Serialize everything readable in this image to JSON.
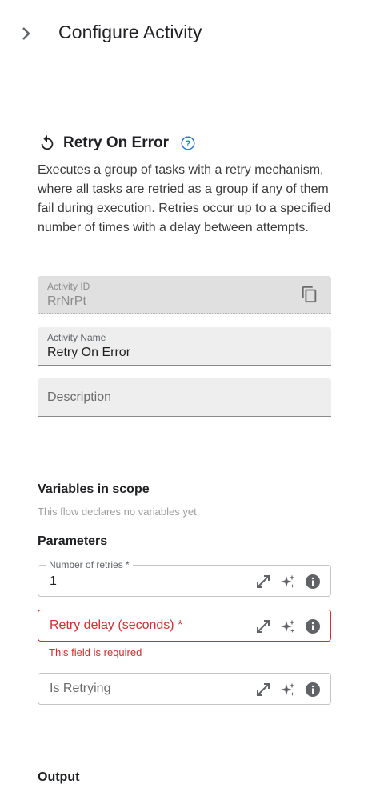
{
  "header": {
    "title": "Configure Activity",
    "expand_icon": "chevron-right-icon"
  },
  "activity": {
    "name": "Retry On Error",
    "icon": "retry-icon",
    "help_icon": "help-circle-icon",
    "description": "Executes a group of tasks with a retry mechanism, where all tasks are retried as a group if any of them fail during execution. Retries occur up to a specified number of times with a delay between attempts."
  },
  "fields": {
    "activity_id": {
      "label": "Activity ID",
      "value": "RrNrPt",
      "icon": "copy-icon"
    },
    "activity_name": {
      "label": "Activity Name",
      "value": "Retry On Error"
    },
    "description": {
      "placeholder": "Description"
    }
  },
  "variables": {
    "title": "Variables in scope",
    "note": "This flow declares no variables yet."
  },
  "parameters": {
    "title": "Parameters",
    "retries": {
      "label": "Number of retries *",
      "value": "1"
    },
    "retry_delay": {
      "placeholder": "Retry delay (seconds) *",
      "error": "This field is required"
    },
    "is_retrying": {
      "placeholder": "Is Retrying"
    },
    "field_icons": [
      "expand-icon",
      "sparkle-icon",
      "info-icon"
    ]
  },
  "output": {
    "title": "Output"
  },
  "colors": {
    "error": "#d32f2f",
    "accent": "#1a73e8",
    "field_bg": "#eeeeee"
  }
}
